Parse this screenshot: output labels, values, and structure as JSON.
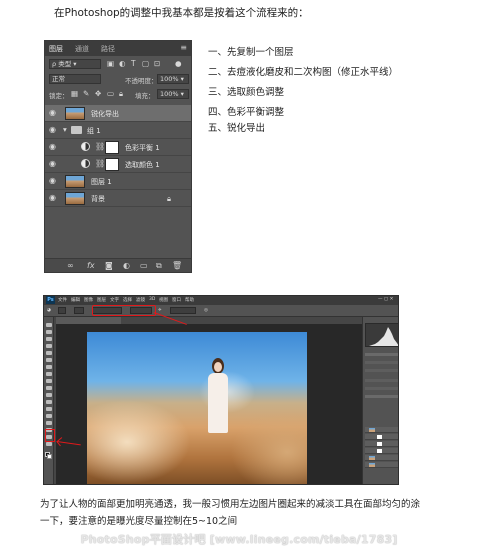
{
  "intro": "在Photoshop的调整中我基本都是按着这个流程来的：",
  "layers_panel": {
    "tabs": [
      "图层",
      "通道",
      "路径"
    ],
    "menu_icon": "panel-menu-icon",
    "filter_label": "ρ 类型",
    "blend_mode": "正常",
    "opacity_label": "不透明度：",
    "opacity_value": "100%",
    "lock_label": "锁定：",
    "fill_label": "填充：",
    "fill_value": "100%",
    "layers": [
      {
        "name": "锐化导出",
        "kind": "pixel",
        "selected": true
      },
      {
        "name": "组 1",
        "kind": "group"
      },
      {
        "name": "色彩平衡 1",
        "kind": "adjustment"
      },
      {
        "name": "选取颜色 1",
        "kind": "adjustment"
      },
      {
        "name": "图层 1",
        "kind": "pixel"
      },
      {
        "name": "背景",
        "kind": "background"
      }
    ],
    "footer_icons": [
      "link-icon",
      "fx-icon",
      "mask-icon",
      "adjustment-icon",
      "folder-icon",
      "new-layer-icon",
      "trash-icon"
    ],
    "footer_fx": "fx"
  },
  "steps": [
    "一、先复制一个图层",
    "二、去痘液化磨皮和二次构图（修正水平线）",
    "三、选取颜色调整",
    "四、色彩平衡调整",
    "五、锐化导出"
  ],
  "photoshop_screenshot": {
    "logo": "Ps",
    "menu_items": [
      "文件",
      "编辑",
      "图像",
      "图层",
      "文字",
      "选择",
      "滤镜",
      "3D",
      "视图",
      "窗口",
      "帮助"
    ],
    "annotation_color": "#e0191b"
  },
  "paragraph": "为了让人物的面部更加明亮通透，我一般习惯用左边图片圈起来的减淡工具在面部均匀的涂一下，要注意的是曝光度尽量控制在5~10之间",
  "watermark": "PhotoShop平面设计吧 [www.lineeg.com/tieba/1783]"
}
